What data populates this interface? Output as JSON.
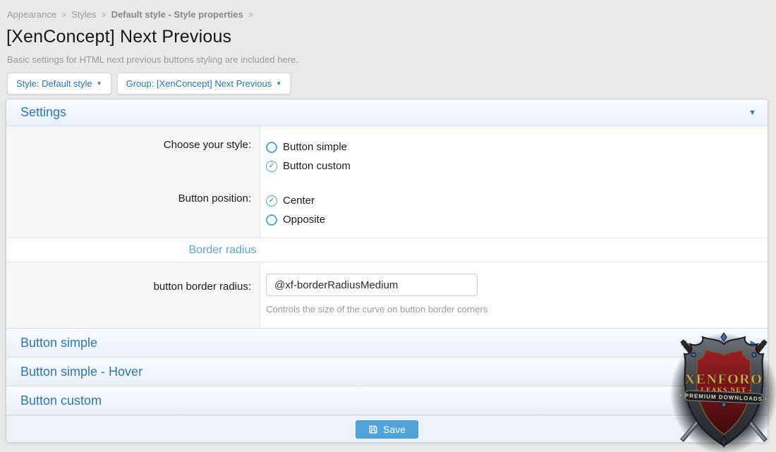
{
  "breadcrumb": {
    "separator": ">",
    "items": [
      {
        "label": "Appearance"
      },
      {
        "label": "Styles"
      },
      {
        "label": "Default style - Style properties"
      }
    ]
  },
  "header": {
    "title": "[XenConcept] Next Previous",
    "subtitle": "Basic settings for HTML next previous buttons styling are included here."
  },
  "filters": {
    "style_button_label": "Style: Default style",
    "group_button_label": "Group: [XenConcept] Next Previous"
  },
  "icons": {
    "dropdown_arrow": "▼",
    "collapse_open_arrow": "▼",
    "collapse_closed_arrow": "▶"
  },
  "settings": {
    "title": "Settings",
    "rows": [
      {
        "label": "Choose your style:",
        "options": [
          {
            "label": "Button simple",
            "checked": false
          },
          {
            "label": "Button custom",
            "checked": true
          }
        ]
      },
      {
        "label": "Button position:",
        "options": [
          {
            "label": "Center",
            "checked": true
          },
          {
            "label": "Opposite",
            "checked": false
          }
        ]
      }
    ],
    "minor_header": "Border radius",
    "input_row": {
      "label": "button border radius:",
      "value": "@xf-borderRadiusMedium",
      "explain": "Controls the size of the curve on button border corners"
    }
  },
  "collapsed_sections": [
    {
      "title": "Button simple"
    },
    {
      "title": "Button simple - Hover"
    },
    {
      "title": "Button custom"
    }
  ],
  "footer": {
    "save_label": "Save"
  },
  "watermark": {
    "line1": "XENFORO",
    "line2": "- LEAKS.NET -",
    "line3": "· PREMIUM DOWNLOADS ·"
  },
  "colors": {
    "accent_blue": "#2e77ad",
    "control_blue": "#55a5d6",
    "save_button_bg": "#51a3da",
    "page_bg": "#e9e9e9"
  }
}
